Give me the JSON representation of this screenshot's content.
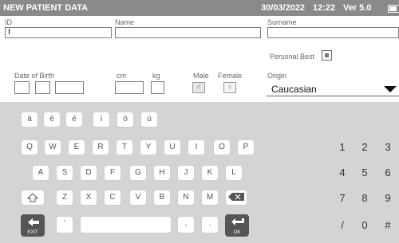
{
  "header": {
    "title": "NEW PATIENT DATA",
    "date": "30/03/2022",
    "time": "12:22",
    "version": "Ver 5.0"
  },
  "form": {
    "id_label": "ID",
    "id_value": "I",
    "name_label": "Name",
    "surname_label": "Surname",
    "personal_best_label": "Personal Best",
    "dob_label": "Date of Birth",
    "cm_label": "cm",
    "kg_label": "kg",
    "male_label": "Male",
    "female_label": "Female",
    "male_icon": "♂",
    "female_icon": "♀",
    "origin_label": "Origin",
    "origin_value": "Caucasian"
  },
  "keyboard": {
    "accents": [
      "à",
      "è",
      "é",
      "ì",
      "ò",
      "ù"
    ],
    "row1": [
      "Q",
      "W",
      "E",
      "R",
      "T",
      "Y",
      "U",
      "I",
      "O",
      "P"
    ],
    "row2": [
      "A",
      "S",
      "D",
      "F",
      "G",
      "H",
      "J",
      "K",
      "L"
    ],
    "row3": [
      "Z",
      "X",
      "C",
      "V",
      "B",
      "N",
      "M"
    ],
    "apostrophe": "'",
    "comma": ",",
    "dot": ".",
    "exit_label": "EXIT",
    "ok_label": "OK",
    "numpad": [
      [
        "1",
        "2",
        "3"
      ],
      [
        "4",
        "5",
        "6"
      ],
      [
        "7",
        "8",
        "9"
      ],
      [
        "/",
        "0",
        "#"
      ]
    ]
  },
  "icons": {
    "shift": "shift-arrow-icon",
    "backspace": "backspace-icon",
    "exit": "exit-arrow-icon",
    "enter": "enter-arrow-icon",
    "battery": "battery-icon"
  }
}
